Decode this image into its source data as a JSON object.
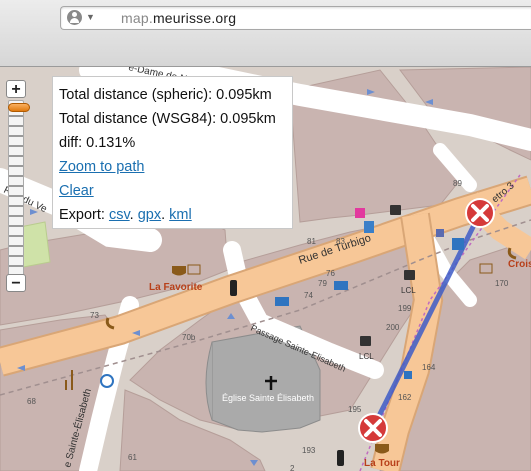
{
  "browser": {
    "url_host": "map.",
    "url_domain": "meurisse.org",
    "icons": [
      "person-icon",
      "chevron-down-icon"
    ]
  },
  "zoom": {
    "plus_label": "+",
    "minus_label": "−"
  },
  "popup": {
    "spheric_label": "Total distance (spheric): 0.095km",
    "wgs84_label": "Total distance (WSG84): 0.095km",
    "diff_label": "diff: 0.131%",
    "zoom_link": "Zoom to path",
    "clear_link": "Clear",
    "export_label": "Export:",
    "export_csv": "csv",
    "export_gpx": "gpx",
    "export_kml": "kml",
    "sep1": ".",
    "sep2": ".",
    "sep3": ""
  },
  "map": {
    "streets": {
      "turbigo": "Rue de Turbigo",
      "passage": "Passage Sainte-Elisabeth",
      "vertbois": "Rue du Ve",
      "dame": "e-Dame de Na",
      "elisabeth": "e Sainte-Élisabeth",
      "metro": "etro 3",
      "crois": "Crois"
    },
    "pois": {
      "favorite": "La Favorite",
      "latour": "La Tour",
      "eglise": "Église Sainte Élisabeth",
      "lcl1": "LCL",
      "lcl2": "LCL"
    },
    "house_numbers": [
      "89",
      "81",
      "83",
      "79",
      "74",
      "76",
      "73",
      "199",
      "200",
      "195",
      "193",
      "68",
      "164",
      "170",
      "162",
      "70b",
      "61",
      "2"
    ],
    "colors": {
      "road": "#f7c797",
      "road_edge": "#d9a676",
      "building": "#c9b4b0",
      "background": "#d9d0c9",
      "route": "#3d5cc7",
      "link": "#1a6fb0"
    }
  }
}
